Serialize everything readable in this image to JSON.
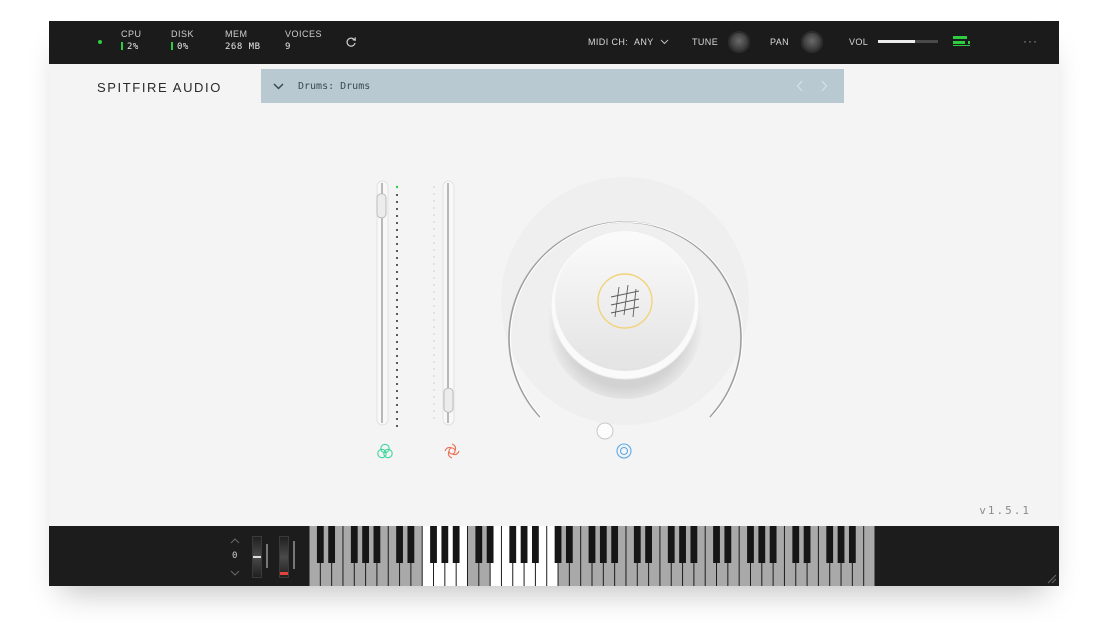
{
  "topbar": {
    "cpu": {
      "label": "CPU",
      "value": "2%"
    },
    "disk": {
      "label": "DISK",
      "value": "0%"
    },
    "mem": {
      "label": "MEM",
      "value": "268 MB"
    },
    "voices": {
      "label": "VOICES",
      "value": "9"
    },
    "midi_label": "MIDI CH:",
    "midi_value": "ANY",
    "tune_label": "TUNE",
    "pan_label": "PAN",
    "vol_label": "VOL",
    "vol_level": 0.62
  },
  "brand": "SPITFIRE AUDIO",
  "preset": {
    "name": "Drums: Drums"
  },
  "faders": {
    "expression_level": 0.95,
    "dynamics_level": 0.05
  },
  "big_knob_level": 0.5,
  "version": "v1.5.1",
  "keyboard": {
    "octave_value": "0"
  },
  "colors": {
    "accent_green": "#2ecc40",
    "preset_bar": "#b9c9d1",
    "icon_green": "#3fd69e",
    "icon_red": "#e9725a",
    "icon_blue": "#5aa9e6",
    "logo_ring": "#f2d37a"
  }
}
